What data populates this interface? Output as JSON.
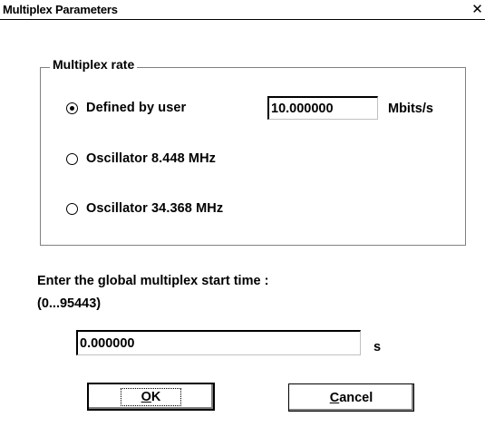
{
  "window": {
    "title": "Multiplex Parameters",
    "close_glyph": "✕"
  },
  "rate_group": {
    "label": "Multiplex rate",
    "options": [
      {
        "label": "Defined by user",
        "checked": true
      },
      {
        "label": "Oscillator 8.448 MHz",
        "checked": false
      },
      {
        "label": "Oscillator 34.368 MHz",
        "checked": false
      }
    ],
    "user_rate_value": "10.000000",
    "user_rate_unit": "Mbits/s"
  },
  "start_time": {
    "prompt": "Enter the global multiplex start time :",
    "range": "(0...95443)",
    "value": "0.000000",
    "unit": "s"
  },
  "buttons": {
    "ok_mnemonic": "O",
    "ok_rest": "K",
    "cancel_mnemonic": "C",
    "cancel_rest": "ancel"
  },
  "icons": {
    "close": "close-icon"
  }
}
